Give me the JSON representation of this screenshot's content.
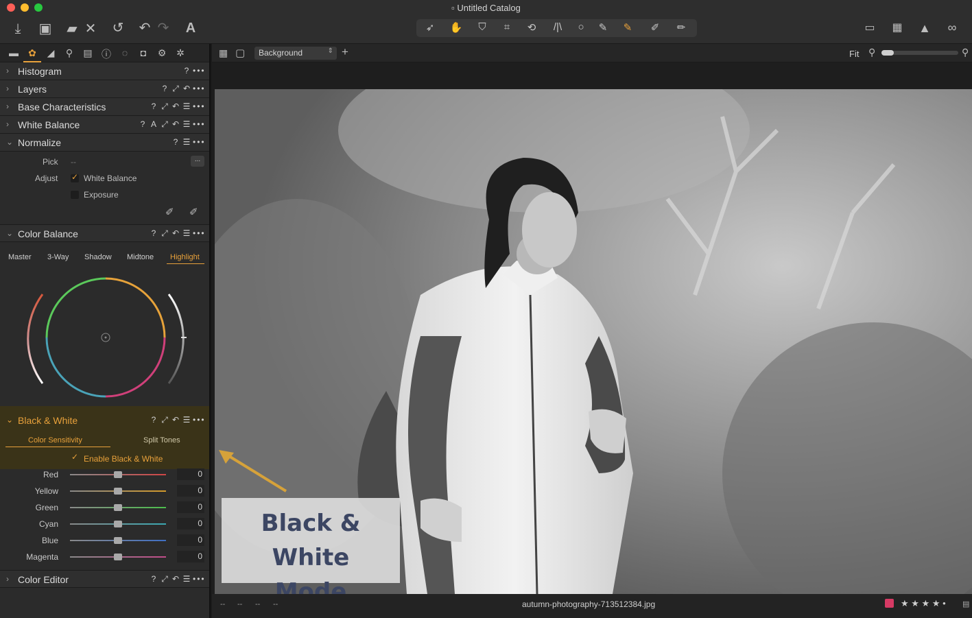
{
  "window": {
    "title": "Untitled Catalog"
  },
  "tool_tabs": [
    "library-icon",
    "color-icon",
    "exposure-icon",
    "lens-icon",
    "adjustments-icon",
    "metadata-icon",
    "output-icon",
    "capture-icon",
    "gear-icon",
    "batch-icon"
  ],
  "tools": {
    "histogram": {
      "name": "Histogram",
      "icons": [
        "?",
        "•••"
      ]
    },
    "layers": {
      "name": "Layers",
      "icons": [
        "?",
        "⤢",
        "↶",
        "•••"
      ]
    },
    "base": {
      "name": "Base Characteristics",
      "icons": [
        "?",
        "⤢",
        "↶",
        "☰",
        "•••"
      ]
    },
    "white_balance": {
      "name": "White Balance",
      "icons": [
        "?",
        "A",
        "⤢",
        "↶",
        "☰",
        "•••"
      ]
    },
    "normalize": {
      "name": "Normalize",
      "icons": [
        "?",
        "☰",
        "•••"
      ],
      "pick_label": "Pick",
      "pick_value": "--",
      "pick_btn": "...",
      "adjust_label": "Adjust",
      "options": [
        {
          "label": "White Balance",
          "checked": true
        },
        {
          "label": "Exposure",
          "checked": false
        }
      ]
    },
    "color_balance": {
      "name": "Color Balance",
      "icons": [
        "?",
        "⤢",
        "↶",
        "☰",
        "•••"
      ],
      "tabs": [
        "Master",
        "3-Way",
        "Shadow",
        "Midtone",
        "Highlight"
      ],
      "active_tab": "Highlight"
    },
    "bw": {
      "name": "Black & White",
      "icons": [
        "?",
        "⤢",
        "↶",
        "☰",
        "•••"
      ],
      "tabs": [
        "Color Sensitivity",
        "Split Tones"
      ],
      "enable_label": "Enable Black & White",
      "sliders": [
        {
          "name": "Red",
          "value": "0",
          "color": "#d04545"
        },
        {
          "name": "Yellow",
          "value": "0",
          "color": "#d49a2a"
        },
        {
          "name": "Green",
          "value": "0",
          "color": "#4cbf4c"
        },
        {
          "name": "Cyan",
          "value": "0",
          "color": "#3aa9b3"
        },
        {
          "name": "Blue",
          "value": "0",
          "color": "#3f6fc4"
        },
        {
          "name": "Magenta",
          "value": "0",
          "color": "#c24c8a"
        }
      ]
    },
    "color_editor": {
      "name": "Color Editor",
      "icons": [
        "?",
        "⤢",
        "↶",
        "☰",
        "•••"
      ]
    }
  },
  "viewer": {
    "variant_select": "Background",
    "zoom_label": "Fit",
    "filename": "autumn-photography-713512384.jpg",
    "status_left": [
      "--",
      "--",
      "--",
      "--"
    ],
    "rating": "★ ★ ★ ★ •",
    "color_tag": "#d63a64"
  },
  "annotation": {
    "line1": "Black & White",
    "line2": "Mode"
  },
  "colors": {
    "accent": "#e8a13b"
  }
}
